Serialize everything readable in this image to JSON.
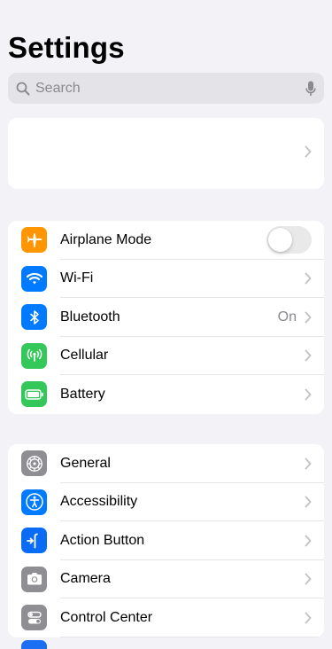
{
  "header": {
    "title": "Settings"
  },
  "search": {
    "placeholder": "Search"
  },
  "group1": [
    {
      "label": "Airplane Mode",
      "icon": "airplane-icon",
      "color": "#ff9500",
      "toggle": false
    },
    {
      "label": "Wi-Fi",
      "icon": "wifi-icon",
      "color": "#007aff"
    },
    {
      "label": "Bluetooth",
      "icon": "bluetooth-icon",
      "color": "#007aff",
      "value": "On"
    },
    {
      "label": "Cellular",
      "icon": "cellular-icon",
      "color": "#34c759"
    },
    {
      "label": "Battery",
      "icon": "battery-icon",
      "color": "#34c759"
    }
  ],
  "group2": [
    {
      "label": "General",
      "icon": "gear-icon",
      "color": "#8e8e93"
    },
    {
      "label": "Accessibility",
      "icon": "accessibility-icon",
      "color": "#007aff"
    },
    {
      "label": "Action Button",
      "icon": "action-button-icon",
      "color": "#0a6cf5"
    },
    {
      "label": "Camera",
      "icon": "camera-icon",
      "color": "#8e8e93"
    },
    {
      "label": "Control Center",
      "icon": "control-center-icon",
      "color": "#8e8e93"
    }
  ]
}
